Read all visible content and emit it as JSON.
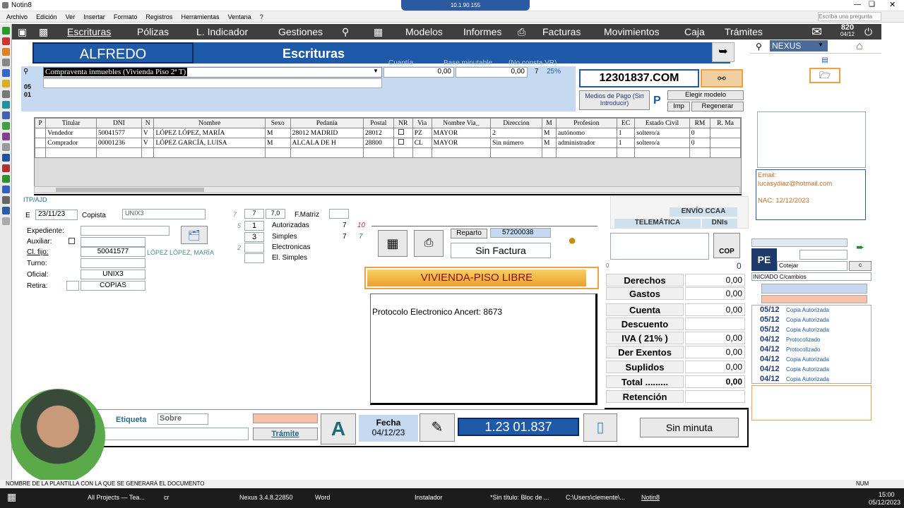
{
  "window": {
    "title": "Notin8",
    "search_placeholder": "Escriba una pregunta"
  },
  "remote": {
    "label": "10.1.90.155"
  },
  "menu": [
    "Archivo",
    "Edición",
    "Ver",
    "Insertar",
    "Formato",
    "Registros",
    "Herramientas",
    "Ventana",
    "?"
  ],
  "nav": {
    "escrituras": "Escrituras",
    "polizas": "Pólizas",
    "indicador": "L. Indicador",
    "gestiones": "Gestiones",
    "modelos": "Modelos",
    "informes": "Informes",
    "facturas": "Facturas",
    "movimientos": "Movimientos",
    "caja": "Caja",
    "tramites": "Trámites",
    "counter": "820",
    "counter_date": "04/12"
  },
  "header": {
    "user": "ALFREDO",
    "section": "Escrituras",
    "cuantia_label": "Cuantía",
    "base_label": "Base minutable",
    "no_consta_label": "(No consta VR)",
    "ref_id": "12301837.COM"
  },
  "acto": {
    "description": "Compraventa inmuebles (Vivienda Piso 2ª T)",
    "cuantia": "0,00",
    "base": "0,00",
    "num": "7",
    "pct": "25%",
    "side_a": "05",
    "side_b": "01"
  },
  "buttons": {
    "medios_pago": "Medios de Pago (Sin Introducir)",
    "elegir_modelo": "Elegir modelo",
    "imp": "Imp",
    "regenerar": "Regenerar",
    "reparto": "Reparto",
    "reparto_num": "57200038",
    "sin_factura": "Sin Factura",
    "cop": "COP",
    "tramite": "Trámite",
    "sin_minuta": "Sin minuta",
    "etiqueta": "Etiqueta",
    "sobre": "Sobre",
    "envio": "ENVÍO CCAA",
    "telematica": "TELEMÁTICA",
    "dnis": "DNIs"
  },
  "parties": {
    "headers": [
      "P",
      "Titular",
      "DNI",
      "N",
      "Nombre",
      "Sexo",
      "Pedanía",
      "Postal",
      "NR",
      "Via",
      "Nombre Via_",
      "Direccion",
      "M",
      "Profesion",
      "EC",
      "Estado Civil",
      "RM",
      "R. Ma"
    ],
    "rows": [
      [
        "",
        "Vendedor",
        "50041577",
        "V",
        "LÓPEZ LÓPEZ, MARÍA",
        "M",
        "28012 MADRID",
        "28012",
        "",
        "PZ",
        "MAYOR",
        "2",
        "M",
        "autónomo",
        "1",
        "soltero/a",
        "0",
        ""
      ],
      [
        "",
        "Comprador",
        "00001236",
        "V",
        "LÓPEZ GARCÍA, LUISA",
        "M",
        "ALCALA DE H",
        "28800",
        "",
        "CL",
        "MAYOR",
        "Sin número",
        "M",
        "administrador",
        "1",
        "soltero/a",
        "0",
        ""
      ]
    ]
  },
  "itp": "ITP/AJD",
  "form": {
    "e_label": "E",
    "e_date": "23/11/23",
    "copista_label": "Copista",
    "copista_val": "UNIX3",
    "expediente_label": "Expediente:",
    "auxiliar_label": "Auxiliar:",
    "clfijo_label": "Cl. fijo:",
    "clfijo_val": "50041577",
    "clfijo_name": "LÓPEZ LÓPEZ, MARÍA",
    "turno_label": "Turno:",
    "oficial_label": "Oficial:",
    "oficial_val": "UNIX3",
    "retira_label": "Retira:",
    "retira_val": "COPIAS"
  },
  "copies": {
    "n7": "7",
    "n70": "7,0",
    "fmatriz": "F.Matriz",
    "autorizadas": "Autorizadas",
    "simples": "Simples",
    "electronicas": "Electronicas",
    "elsimples": "El. Simples",
    "aut_left": "1",
    "simp_left": "3",
    "aut_right": "7",
    "simp_right": "7",
    "red10": "10",
    "green7": "7",
    "idx7": "7",
    "idx5": "5",
    "idx2": "2"
  },
  "vivienda": "VIVIENDA-PISO LIBRE",
  "protocolo": "Protocolo Electronico Ancert: 8673",
  "totals": [
    {
      "label": "Derechos",
      "value": "0,00"
    },
    {
      "label": "Gastos",
      "value": "0,00"
    },
    {
      "label": "Cuenta",
      "value": "0,00"
    },
    {
      "label": "Descuento",
      "value": ""
    },
    {
      "label": "IVA  (   21%   )",
      "value": "0,00"
    },
    {
      "label": "Der Exentos",
      "value": "0,00"
    },
    {
      "label": "Suplidos",
      "value": "0,00"
    },
    {
      "label": "Total .........",
      "value": "0,00"
    },
    {
      "label": "Retención",
      "value": ""
    }
  ],
  "cuenta_prefix": "A",
  "cop_zero": "0",
  "left_zero": "0",
  "fecha": {
    "label": "Fecha",
    "value": "04/12/23"
  },
  "protocol_number": "1.23 01.837",
  "side": {
    "nexus": "NEXUS",
    "email_label": "Email:",
    "email": "lucasydiaz@hotmail.com",
    "nac": "NAC: 12/12/2023",
    "pe": "PE",
    "cotejar": "Cotejar",
    "c": "c",
    "estado": "INICIADO C/cambios"
  },
  "history": [
    {
      "d": "05/12",
      "n": "Copia Autorizada"
    },
    {
      "d": "05/12",
      "n": "Copia Autorizada"
    },
    {
      "d": "05/12",
      "n": "Copia Autorizada"
    },
    {
      "d": "04/12",
      "n": "Protocolizado"
    },
    {
      "d": "04/12",
      "n": "Protocolizado"
    },
    {
      "d": "04/12",
      "n": "Copia Autorizada"
    },
    {
      "d": "04/12",
      "n": "Copia Autorizada"
    },
    {
      "d": "04/12",
      "n": "Copia Autorizada"
    }
  ],
  "status": "NOMBRE DE LA PLANTILLA CON LA QUE SE GENERARÁ EL DOCUMENTO",
  "status_num": "NUM",
  "taskbar": {
    "allprojects": "All Projects — Tea...",
    "cr": "cr",
    "nexus": "Nexus  3.4.8.22850",
    "word": "Word",
    "instalador": "Instalador",
    "bloc": "*Sin título: Bloc de ...",
    "users": "C:\\Users\\clemente\\...",
    "notin": "Notin8",
    "time": "15:00",
    "date": "05/12/2023"
  },
  "colors": {
    "nav": "#3f3f3f",
    "accent": "#1e5aa8",
    "orange": "#f0a040"
  }
}
